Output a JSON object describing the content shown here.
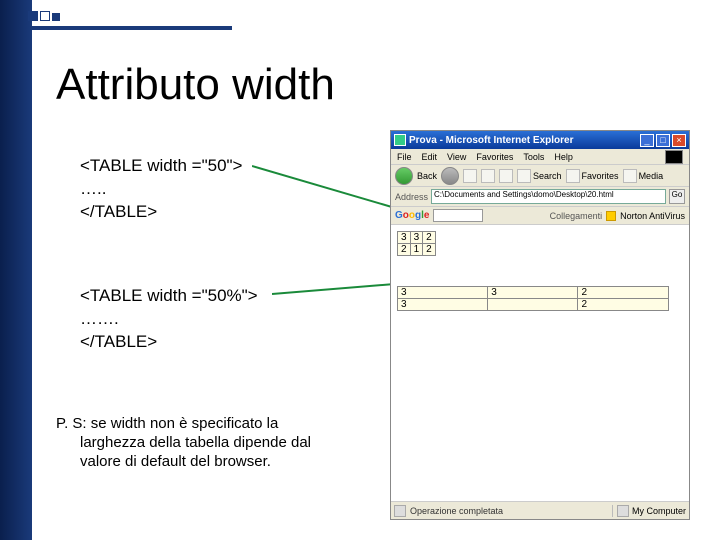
{
  "title": "Attributo width",
  "code1": {
    "line1": "<TABLE  width =\"50\">",
    "line2": "…..",
    "line3": "</TABLE>"
  },
  "code2": {
    "line1": "<TABLE  width =\"50%\">",
    "line2": "…….",
    "line3": "</TABLE>"
  },
  "ps": {
    "line1": "P. S: se width non è specificato la",
    "line2": "larghezza della tabella dipende dal",
    "line3": "valore di default del browser."
  },
  "browser": {
    "title": "Prova - Microsoft Internet Explorer",
    "menus": [
      "File",
      "Edit",
      "View",
      "Favorites",
      "Tools",
      "Help"
    ],
    "back_label": "Back",
    "toolbar_labels": {
      "search": "Search",
      "favorites": "Favorites",
      "media": "Media"
    },
    "address_label": "Address",
    "address_value": "C:\\Documents and Settings\\domo\\Desktop\\20.html",
    "go_label": "Go",
    "google": "Google",
    "collegamenti": "Collegamenti",
    "norton": "Norton AntiVirus",
    "status_text": "Operazione completata",
    "zone_text": "My Computer",
    "window_buttons": {
      "min": "_",
      "max": "□",
      "close": "×"
    }
  },
  "table1": [
    [
      "3",
      "3",
      "2"
    ],
    [
      "2",
      "1",
      "2"
    ]
  ],
  "table2": [
    [
      "3",
      "3",
      "2"
    ],
    [
      "3",
      "",
      "2"
    ]
  ]
}
